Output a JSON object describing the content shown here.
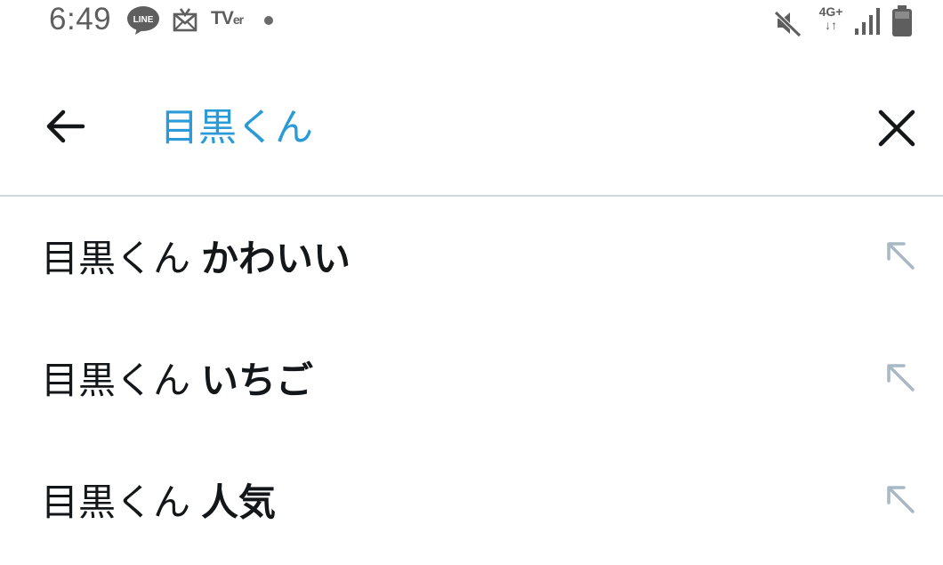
{
  "status_bar": {
    "time": "6:49",
    "line_badge": "LINE",
    "tver_main": "TV",
    "tver_sub": "er",
    "network_type": "4G+",
    "network_arrows": "↓↑",
    "icons": [
      "line-icon",
      "mail-icon",
      "tver-icon",
      "dot-icon",
      "mute-icon",
      "signal-icon",
      "battery-icon"
    ]
  },
  "search": {
    "query": "目黒くん",
    "back_icon": "arrow-left-icon",
    "clear_icon": "close-icon",
    "accent_color": "#2b9bd7"
  },
  "suggestions": [
    {
      "base": "目黒くん",
      "completion": "かわいい"
    },
    {
      "base": "目黒くん",
      "completion": "いちご"
    },
    {
      "base": "目黒くん",
      "completion": "人気"
    }
  ],
  "suggestion_fill_icon": "arrow-up-left-icon",
  "colors": {
    "text": "#14171a",
    "divider": "#cfd9de",
    "fill_arrow": "#a8b8c4",
    "status_icons": "#5e5e5e"
  }
}
